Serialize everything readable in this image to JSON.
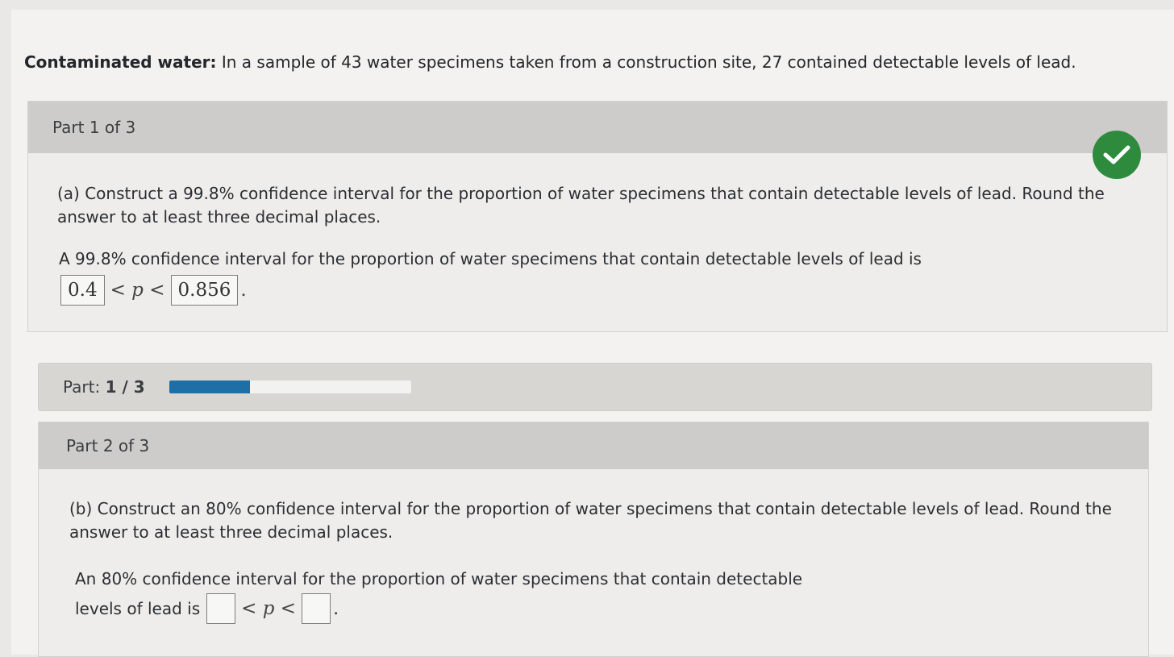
{
  "intro": {
    "label": "Contaminated water:",
    "text": " In a sample of 43 water specimens taken from a construction site, 27 contained detectable levels of lead."
  },
  "part1": {
    "header": "Part 1 of 3",
    "question": "(a) Construct a 99.8% confidence interval for the proportion of water specimens that contain detectable levels of lead. Round the answer to at least three decimal places.",
    "answer_text": "A 99.8% confidence interval for the proportion of water specimens that contain detectable levels of lead is",
    "lower": "0.4",
    "upper": "0.856",
    "lt": "<",
    "p": "p",
    "period": ".",
    "status": "correct"
  },
  "progress": {
    "label": "Part:",
    "value": "1 / 3",
    "fraction": 0.333
  },
  "part2": {
    "header": "Part 2 of 3",
    "question": "(b) Construct an 80% confidence interval for the proportion of water specimens that contain detectable levels of lead. Round the answer to at least three decimal places.",
    "answer_text_line1": "An 80% confidence interval for the proportion of water specimens that contain detectable",
    "answer_text_line2": "levels of lead is",
    "lower": "",
    "upper": "",
    "lt": "<",
    "p": "p",
    "period": "."
  },
  "colors": {
    "check": "#2e8b3e",
    "progress_fill": "#1f6fa7"
  }
}
